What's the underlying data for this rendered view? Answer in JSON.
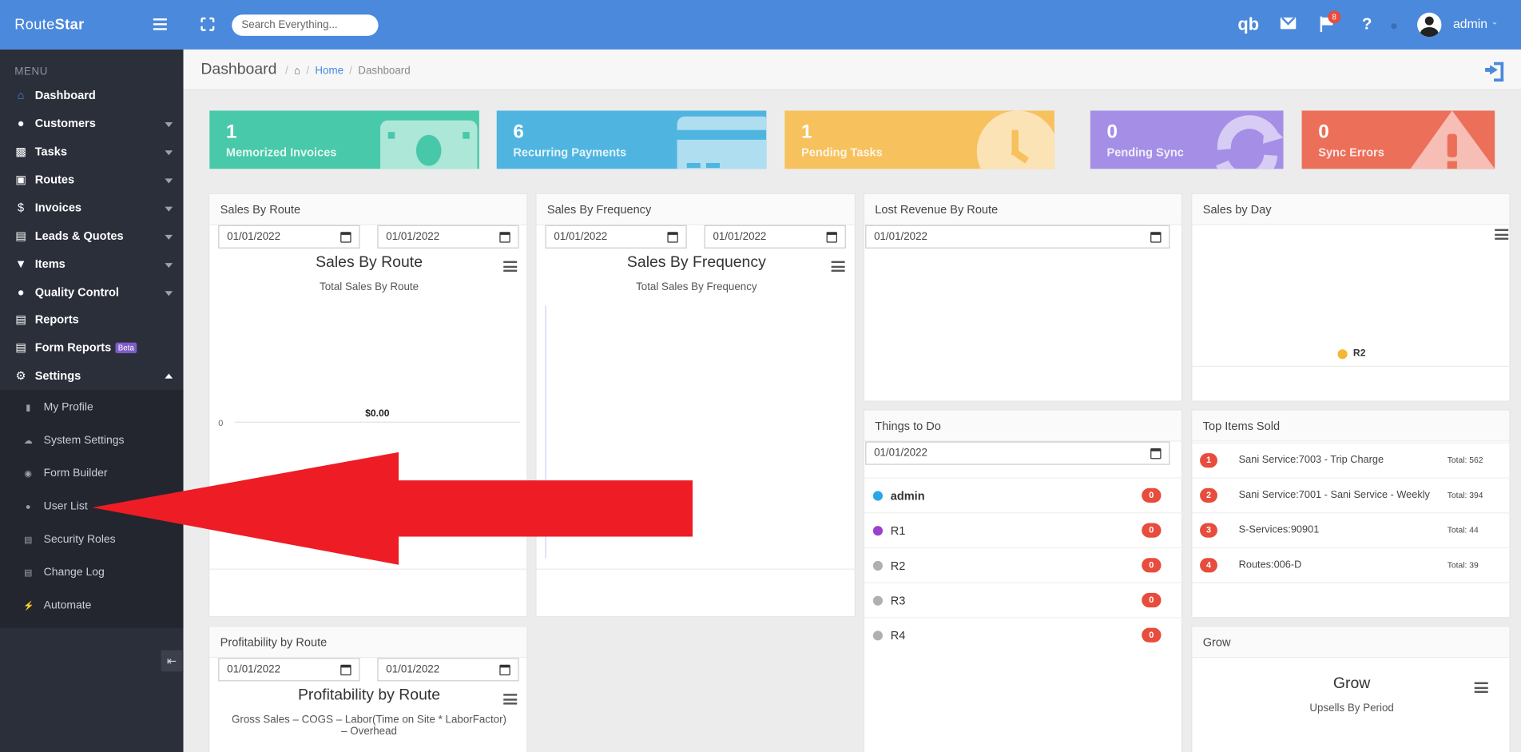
{
  "app": {
    "brand_a": "Route",
    "brand_b": "Star",
    "search_placeholder": "Search Everything...",
    "notif_count": "8",
    "username": "admin",
    "qb": "qb",
    "help": "?"
  },
  "sidebar": {
    "menu_label": "MENU",
    "items": [
      {
        "label": "Dashboard",
        "icon": "home-icon"
      },
      {
        "label": "Customers",
        "icon": "user-icon"
      },
      {
        "label": "Tasks",
        "icon": "clipboard-icon"
      },
      {
        "label": "Routes",
        "icon": "truck-icon"
      },
      {
        "label": "Invoices",
        "icon": "dollar-icon"
      },
      {
        "label": "Leads & Quotes",
        "icon": "document-icon"
      },
      {
        "label": "Items",
        "icon": "cart-icon"
      },
      {
        "label": "Quality Control",
        "icon": "user-check-icon"
      },
      {
        "label": "Reports",
        "icon": "report-icon"
      },
      {
        "label": "Form Reports",
        "icon": "report-icon",
        "badge": "Beta"
      },
      {
        "label": "Settings",
        "icon": "gear-icon"
      }
    ],
    "settings_items": [
      {
        "label": "My Profile",
        "icon": "bookmark-icon"
      },
      {
        "label": "System Settings",
        "icon": "cloud-icon"
      },
      {
        "label": "Form Builder",
        "icon": "form-icon"
      },
      {
        "label": "User List",
        "icon": "user-icon"
      },
      {
        "label": "Security Roles",
        "icon": "book-icon"
      },
      {
        "label": "Change Log",
        "icon": "list-icon"
      },
      {
        "label": "Automate",
        "icon": "bolt-icon"
      }
    ]
  },
  "breadcrumb": {
    "title": "Dashboard",
    "home_link": "Home",
    "current": "Dashboard"
  },
  "stats": [
    {
      "value": "1",
      "label": "Memorized Invoices",
      "color": "#48c9a9"
    },
    {
      "value": "6",
      "label": "Recurring Payments",
      "color": "#4fb5e0"
    },
    {
      "value": "1",
      "label": "Pending Tasks",
      "color": "#f7c15d"
    },
    {
      "value": "0",
      "label": "Pending Sync",
      "color": "#a58ee6"
    },
    {
      "value": "0",
      "label": "Sync Errors",
      "color": "#ec6f5a"
    }
  ],
  "panels": {
    "sales_by_route": {
      "header": "Sales By Route",
      "date_from": "01/01/2022",
      "date_to": "01/01/2022",
      "chart_title": "Sales By Route",
      "chart_subtitle": "Total Sales By Route",
      "y_tick": "0",
      "value_label": "$0.00"
    },
    "sales_by_frequency": {
      "header": "Sales By Frequency",
      "date_from": "01/01/2022",
      "date_to": "01/01/2022",
      "chart_title": "Sales By Frequency",
      "chart_subtitle": "Total Sales By Frequency"
    },
    "lost_revenue": {
      "header": "Lost Revenue By Route",
      "date": "01/01/2022"
    },
    "sales_by_day": {
      "header": "Sales by Day",
      "legend": "R2"
    },
    "things_to_do": {
      "header": "Things to Do",
      "date": "01/01/2022",
      "rows": [
        {
          "name": "admin",
          "count": "0",
          "color": "#29a8e8"
        },
        {
          "name": "R1",
          "count": "0",
          "color": "#9b3fcf"
        },
        {
          "name": "R2",
          "count": "0",
          "color": "#b0b0b0"
        },
        {
          "name": "R3",
          "count": "0",
          "color": "#b0b0b0"
        },
        {
          "name": "R4",
          "count": "0",
          "color": "#b0b0b0"
        }
      ]
    },
    "top_items": {
      "header": "Top Items Sold",
      "rows": [
        {
          "rank": "1",
          "name": "Sani Service:7003 - Trip Charge",
          "total": "Total: 562"
        },
        {
          "rank": "2",
          "name": "Sani Service:7001 - Sani Service - Weekly",
          "total": "Total: 394"
        },
        {
          "rank": "3",
          "name": "S-Services:90901",
          "total": "Total: 44"
        },
        {
          "rank": "4",
          "name": "Routes:006-D",
          "total": "Total: 39"
        }
      ]
    },
    "profitability": {
      "header": "Profitability by Route",
      "date_from": "01/01/2022",
      "date_to": "01/01/2022",
      "chart_title": "Profitability by Route",
      "chart_subtitle_1": "Gross Sales – COGS – Labor(Time on Site * LaborFactor)",
      "chart_subtitle_2": "– Overhead"
    },
    "grow": {
      "header": "Grow",
      "chart_title": "Grow",
      "chart_subtitle": "Upsells By Period"
    }
  },
  "chart_data": [
    {
      "type": "bar",
      "title": "Sales By Route",
      "subtitle": "Total Sales By Route",
      "categories": [],
      "values": [
        0
      ],
      "data_labels": [
        "$0.00"
      ],
      "yticks": [
        "0"
      ]
    },
    {
      "type": "bar",
      "title": "Sales By Frequency",
      "subtitle": "Total Sales By Frequency",
      "categories": [],
      "values": []
    },
    {
      "type": "pie",
      "title": "",
      "legend": [
        "R2"
      ],
      "values": []
    }
  ],
  "colors": {
    "topbar": "#4a89dc",
    "sidebar": "#2b2f3a",
    "badge": "#e74c3c",
    "annotation_arrow": "#ee1c25"
  }
}
